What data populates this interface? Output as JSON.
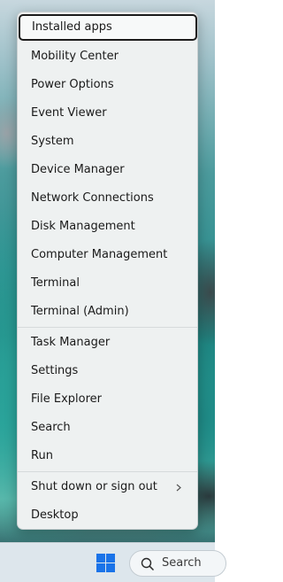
{
  "menu": {
    "group1": [
      {
        "label": "Installed apps",
        "focused": true
      },
      {
        "label": "Mobility Center"
      },
      {
        "label": "Power Options"
      },
      {
        "label": "Event Viewer"
      },
      {
        "label": "System"
      },
      {
        "label": "Device Manager"
      },
      {
        "label": "Network Connections"
      },
      {
        "label": "Disk Management"
      },
      {
        "label": "Computer Management"
      },
      {
        "label": "Terminal"
      },
      {
        "label": "Terminal (Admin)"
      }
    ],
    "group2": [
      {
        "label": "Task Manager"
      },
      {
        "label": "Settings"
      },
      {
        "label": "File Explorer"
      },
      {
        "label": "Search"
      },
      {
        "label": "Run"
      }
    ],
    "group3": [
      {
        "label": "Shut down or sign out",
        "submenu": true,
        "icon": "chevron-right-icon"
      },
      {
        "label": "Desktop"
      }
    ]
  },
  "taskbar": {
    "start_icon": "windows-logo-icon",
    "search_label": "Search",
    "search_icon": "search-icon",
    "accent": "#1a73e8"
  }
}
